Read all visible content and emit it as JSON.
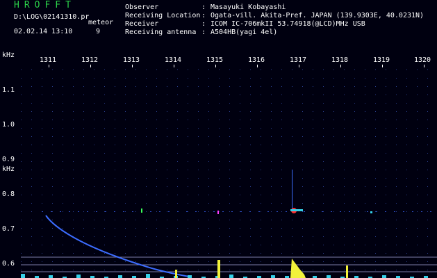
{
  "header": {
    "app_title": "HROFFT",
    "file_path": "D:\\LOG\\02141310.pr",
    "meteor_label": "meteor",
    "date_time": "02.02.14 13:10",
    "count": "9"
  },
  "station": [
    {
      "label": "Observer",
      "value": "Masayuki Kobayashi"
    },
    {
      "label": "Receiving Location",
      "value": "Ogata-vill. Akita-Pref. JAPAN (139.9303E, 40.0231N)"
    },
    {
      "label": "Receiver",
      "value": "ICOM IC-706mkII 53.74918(@LCD)MHz USB"
    },
    {
      "label": "Receiving antenna",
      "value": "A504HB(yagi 4el)"
    }
  ],
  "separator": ":",
  "spectrogram": {
    "x_unit": "kHz",
    "y_unit": "kHz",
    "x_ticks": [
      "1311",
      "1312",
      "1313",
      "1314",
      "1315",
      "1316",
      "1317",
      "1318",
      "1319",
      "1320"
    ],
    "y_ticks": [
      "1.1",
      "1.0",
      "0.9",
      "0.8",
      "0.7",
      "0.6"
    ],
    "colors": {
      "background": "#000010",
      "grid_dot": "#2a3e8c",
      "trace": "#3c6cff",
      "spectrum_cyan": "#36d0e8",
      "spectrum_yellow": "#f2f23a",
      "marker_green": "#3cff5a",
      "marker_magenta": "#ff3cff",
      "marker_red": "#ff3030",
      "level_line": "#7d7da8"
    }
  }
}
